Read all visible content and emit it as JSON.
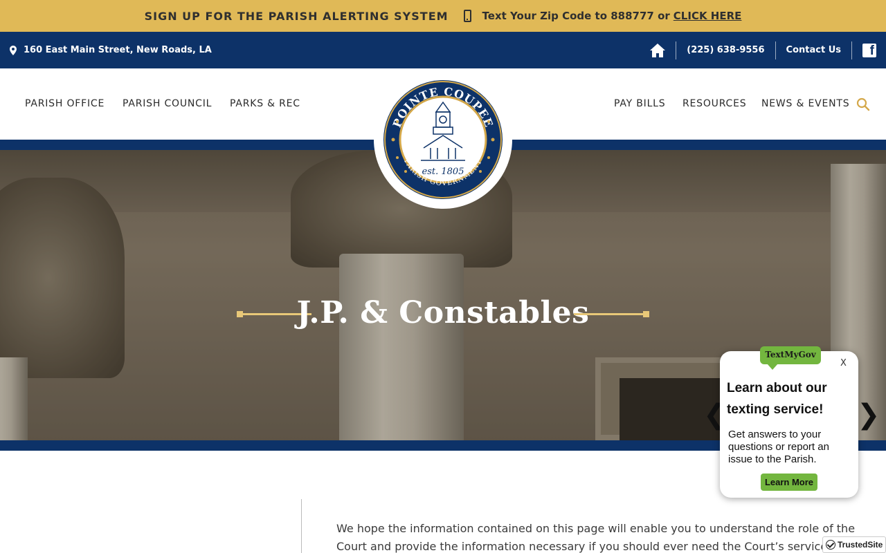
{
  "alert_bar": {
    "signup_text": "SIGN UP FOR THE PARISH ALERTING SYSTEM",
    "text_zip": "Text Your Zip Code to 888777 or",
    "click_here": "CLICK HERE",
    "background_color": "#e0b957"
  },
  "top_bar": {
    "address": "160 East Main Street, New Roads, LA",
    "phone": "(225) 638-9556",
    "contact": "Contact Us",
    "background_color": "#0d3268",
    "icons": [
      "map-pin-icon",
      "home-icon",
      "facebook-icon"
    ]
  },
  "nav": {
    "left": [
      "PARISH OFFICE",
      "PARISH COUNCIL",
      "PARKS & REC"
    ],
    "right": [
      "PAY BILLS",
      "RESOURCES",
      "NEWS & EVENTS"
    ],
    "search_icon": "search-icon"
  },
  "seal": {
    "top_text": "POINTE COUPEE",
    "est": "est. 1805",
    "bottom_text": "PARISH GOVERNMENT"
  },
  "hero": {
    "title": "J.P. & Constables",
    "accent_color": "#e8c878"
  },
  "content": {
    "paragraph": "We hope the information contained on this page will enable you to understand the role of the Court and provide the information necessary if you should ever need the Court’s services."
  },
  "textmygov": {
    "badge": "TextMyGov",
    "close": "X",
    "title": "Learn about our texting service!",
    "body": "Get answers to your questions or report an issue to the Parish.",
    "button": "Learn More",
    "accent_color": "#73b63f"
  },
  "trusted_site": {
    "label": "TrustedSite"
  },
  "carousel": {
    "prev": "❮",
    "next": "❯"
  }
}
